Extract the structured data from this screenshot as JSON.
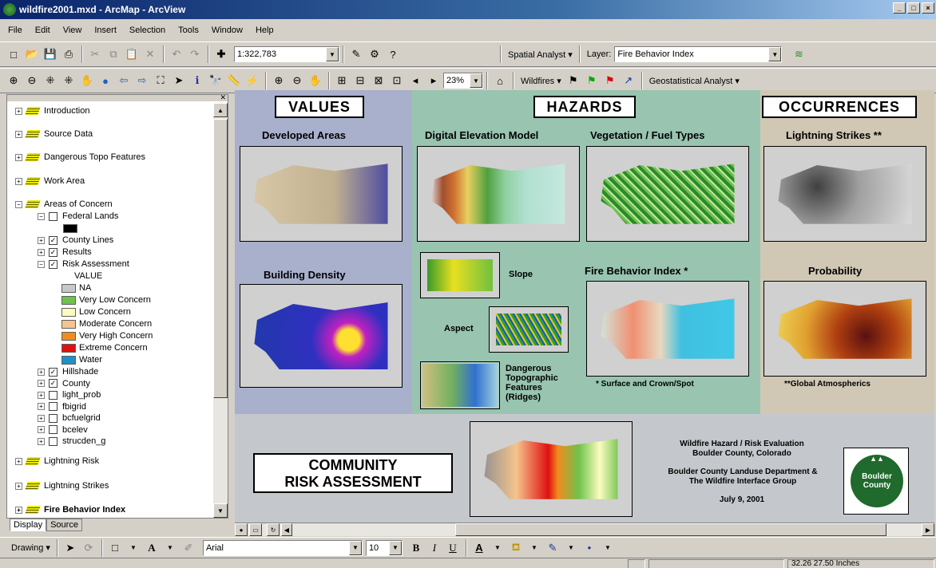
{
  "window": {
    "title": "wildfire2001.mxd - ArcMap - ArcView"
  },
  "menu": [
    "File",
    "Edit",
    "View",
    "Insert",
    "Selection",
    "Tools",
    "Window",
    "Help"
  ],
  "toolbar": {
    "scale": "1:322,783",
    "spatial_analyst": "Spatial Analyst",
    "layer_label": "Layer:",
    "layer_value": "Fire Behavior Index",
    "zoom_percent": "23%",
    "wildfires": "Wildfires",
    "geostatistical": "Geostatistical Analyst"
  },
  "toc": {
    "groups": [
      "Introduction",
      "Source Data",
      "Dangerous Topo Features",
      "Work Area",
      "Areas of Concern"
    ],
    "federal_lands": "Federal Lands",
    "county_lines": "County Lines",
    "results": "Results",
    "risk_assessment": "Risk Assessment",
    "value_heading": "VALUE",
    "legend": [
      {
        "label": "NA",
        "color": "#c8c8c8"
      },
      {
        "label": "Very Low Concern",
        "color": "#6fc24a"
      },
      {
        "label": "Low Concern",
        "color": "#fbfbbe"
      },
      {
        "label": "Moderate Concern",
        "color": "#f5c48c"
      },
      {
        "label": "Very High Concern",
        "color": "#f08c1e"
      },
      {
        "label": "Extreme Concern",
        "color": "#e01010"
      },
      {
        "label": "Water",
        "color": "#2090c8"
      }
    ],
    "layers": [
      {
        "label": "Hillshade",
        "checked": true
      },
      {
        "label": "County",
        "checked": true
      },
      {
        "label": "light_prob",
        "checked": false
      },
      {
        "label": "fbigrid",
        "checked": false
      },
      {
        "label": "bcfuelgrid",
        "checked": false
      },
      {
        "label": "bcelev",
        "checked": false
      },
      {
        "label": "strucden_g",
        "checked": false
      }
    ],
    "groups2": [
      "Lightning Risk",
      "Lightning Strikes",
      "Fire Behavior Index"
    ]
  },
  "tabs": {
    "display": "Display",
    "source": "Source"
  },
  "map": {
    "values_title": "VALUES",
    "hazards_title": "HAZARDS",
    "occurrences_title": "OCCURRENCES",
    "developed_areas": "Developed Areas",
    "building_density": "Building Density",
    "dem": "Digital Elevation Model",
    "vegetation": "Vegetation / Fuel Types",
    "slope": "Slope",
    "aspect": "Aspect",
    "dangerous_topo": [
      "Dangerous",
      "Topographic",
      "Features",
      "(Ridges)"
    ],
    "fbi": "Fire Behavior Index *",
    "fbi_note": "* Surface and Crown/Spot",
    "lightning": "Lightning Strikes **",
    "probability": "Probability",
    "global_note": "**Global Atmospherics",
    "community": [
      "COMMUNITY",
      "RISK ASSESSMENT"
    ],
    "eval_title": [
      "Wildfire Hazard / Risk Evaluation",
      "Boulder County, Colorado"
    ],
    "dept": [
      "Boulder County Landuse Department &",
      "The Wildfire Interface Group"
    ],
    "date": "July 9, 2001",
    "logo": [
      "Boulder",
      "County"
    ]
  },
  "drawing": {
    "label": "Drawing",
    "font": "Arial",
    "size": "10"
  },
  "status": {
    "coords": "32.26  27.50 Inches"
  }
}
